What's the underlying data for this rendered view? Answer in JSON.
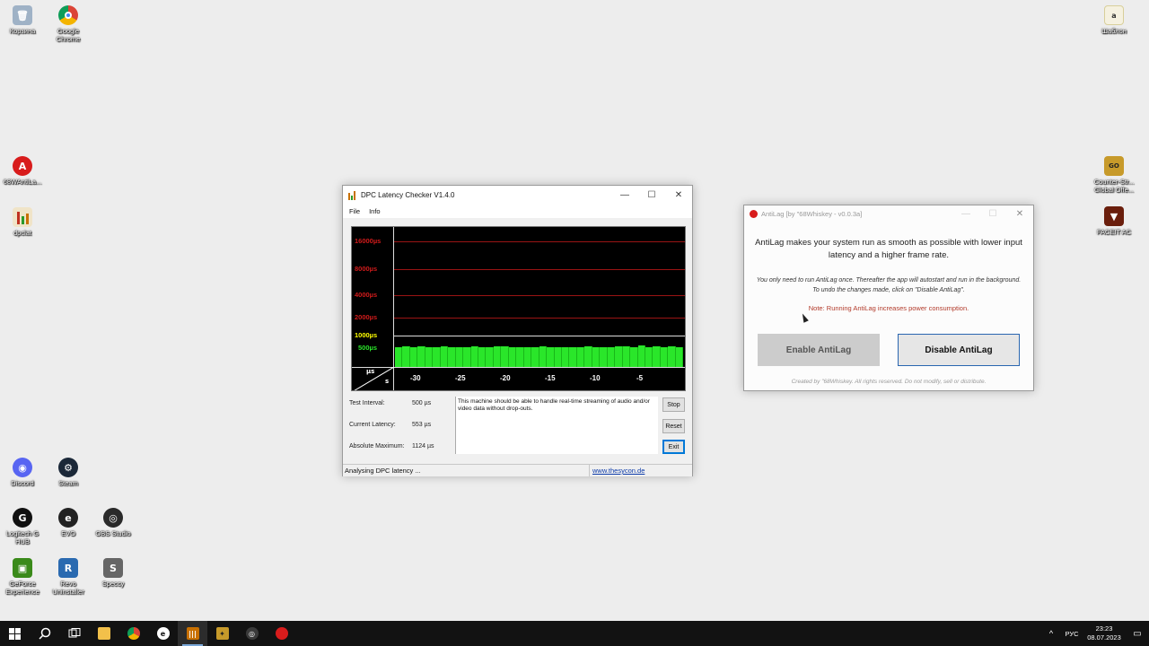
{
  "desktop_icons": [
    {
      "label": "Корзина",
      "icon": "recycle-bin-icon",
      "color": "#8aa0b8"
    },
    {
      "label": "Google Chrome",
      "icon": "chrome-icon",
      "color": "#dd4b39"
    },
    {
      "label": "Шаблон",
      "icon": "folder-icon",
      "color": "#f2d06b"
    },
    {
      "label": "68WAntiLa...",
      "icon": "antilag-icon",
      "color": "#d81c1c"
    },
    {
      "label": "dpclat",
      "icon": "dpclat-icon",
      "color": "#c87000"
    },
    {
      "label": "Counter-Str... Global Offe...",
      "icon": "csgo-icon",
      "color": "#c79a2a"
    },
    {
      "label": "FACEIT AC",
      "icon": "faceit-icon",
      "color": "#7a2a10"
    },
    {
      "label": "Discord",
      "icon": "discord-icon",
      "color": "#5865f2"
    },
    {
      "label": "Steam",
      "icon": "steam-icon",
      "color": "#1b2838"
    },
    {
      "label": "Logitech G HUB",
      "icon": "ghub-icon",
      "color": "#111111"
    },
    {
      "label": "EVO",
      "icon": "evo-icon",
      "color": "#222222"
    },
    {
      "label": "OBS Studio",
      "icon": "obs-icon",
      "color": "#2a2a2a"
    },
    {
      "label": "GeForce Experience",
      "icon": "geforce-icon",
      "color": "#3a8a1a"
    },
    {
      "label": "Revo Uninstaller",
      "icon": "revo-icon",
      "color": "#2a6ab0"
    },
    {
      "label": "Speccy",
      "icon": "speccy-icon",
      "color": "#555555"
    }
  ],
  "dpc": {
    "title": "DPC Latency Checker V1.4.0",
    "menu": [
      "File",
      "Info"
    ],
    "y_labels": [
      {
        "text": "16000µs",
        "color": "#d11b1b"
      },
      {
        "text": "8000µs",
        "color": "#d11b1b"
      },
      {
        "text": "4000µs",
        "color": "#d11b1b"
      },
      {
        "text": "2000µs",
        "color": "#d11b1b"
      },
      {
        "text": "1000µs",
        "color": "#ffff00"
      },
      {
        "text": "500µs",
        "color": "#2ae62a"
      }
    ],
    "x_labels": [
      "-30",
      "-25",
      "-20",
      "-15",
      "-10",
      "-5"
    ],
    "unit_top": "µs",
    "unit_bottom": "s",
    "stats": [
      {
        "label": "Test Interval:",
        "value": "500 µs"
      },
      {
        "label": "Current Latency:",
        "value": "553 µs"
      },
      {
        "label": "Absolute Maximum:",
        "value": "1124 µs"
      }
    ],
    "message": "This machine should be able to handle real-time streaming of audio and/or video data without drop-outs.",
    "buttons": {
      "stop": "Stop",
      "reset": "Reset",
      "exit": "Exit"
    },
    "status": "Analysing DPC latency ...",
    "link": "www.thesycon.de",
    "bar_levels": [
      0.88,
      0.92,
      0.9,
      0.93,
      0.9,
      0.89,
      0.91,
      0.9,
      0.88,
      0.9,
      0.91,
      0.9,
      0.89,
      0.92,
      0.91,
      0.9,
      0.88,
      0.9,
      0.89,
      0.91,
      0.9,
      0.9,
      0.89,
      0.88,
      0.9,
      0.91,
      0.9,
      0.89,
      0.9,
      0.91,
      0.92,
      0.9,
      0.95,
      0.9,
      0.91,
      0.9,
      0.92,
      0.9
    ]
  },
  "antilag": {
    "title": "AntiLag [by \"68Whiskey - v0.0.3a]",
    "main_text": "AntiLag makes your system run as smooth as possible with lower input latency and a higher frame rate.",
    "sub_text": "You only need to run AntiLag once. Thereafter the app will autostart and run in the background. To undo the changes made, click on \"Disable AntiLag\".",
    "note": "Note: Running AntiLag increases power consumption.",
    "enable_label": "Enable AntiLag",
    "disable_label": "Disable AntiLag",
    "footer": "Created by \"68Whiskey. All rights reserved. Do not modify, sell or distribute."
  },
  "taskbar": {
    "lang": "РУС",
    "time": "23:23",
    "date": "08.07.2023"
  }
}
